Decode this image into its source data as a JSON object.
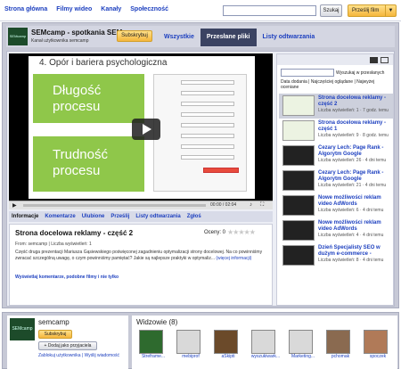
{
  "topbar": {
    "nav": [
      "Strona główna",
      "Filmy wideo",
      "Kanały",
      "Społeczność"
    ],
    "search_button": "Szukaj",
    "upload_button": "Prześlij film"
  },
  "channel": {
    "logo_text": "SEMcamp",
    "title": "SEMcamp - spotkania SEM",
    "subtitle": "Kanał użytkownika semcamp",
    "subscribe": "Subskrybuj",
    "tabs": [
      "Wszystkie",
      "Przesłane pliki",
      "Listy odtwarzania"
    ]
  },
  "player": {
    "slide_title": "4. Opór i bariera psychologiczna",
    "slide_text1": "Długość procesu",
    "slide_text2": "Trudność procesu",
    "time": "00:00 / 02:04"
  },
  "actions": [
    "Informacje",
    "Komentarze",
    "Ulubione",
    "Prześlij",
    "Listy odtwarzania",
    "Zgłoś"
  ],
  "video": {
    "title": "Strona docelowa reklamy - część 2",
    "rating_label": "Oceny: 0",
    "from": "From: semcamp | Liczba wyświetleń: 1",
    "description": "Część druga prezentacji Mariusza Gąsiewskiego poświęconej zagadnieniu optymalizacji strony docelowej. Na co powinniśmy zwracać szczególną uwagę, o czym powinniśmy pamiętać? Jakie są najlepsze praktyki w optymaliz...",
    "more_info": "(więcej informacji)",
    "comments_link": "Wyświetlaj komentarze, podobne filmy i nie tylko"
  },
  "sidebar": {
    "search_label": "Wyszukaj w przesłanych",
    "sort": "Data dodania | Najczęściej oglądane | Najwyżej oceniane",
    "items": [
      {
        "title": "Strona docelowa reklamy - część 2",
        "meta": "Liczba wyświetleń: 1 · 7 godz. temu"
      },
      {
        "title": "Strona docelowa reklamy - część 1",
        "meta": "Liczba wyświetleń: 9 · 8 godz. temu"
      },
      {
        "title": "Cezary Lech: Page Rank - Algorytm Google",
        "meta": "Liczba wyświetleń: 26 · 4 dni temu"
      },
      {
        "title": "Cezary Lech: Page Rank - Algorytm Google",
        "meta": "Liczba wyświetleń: 21 · 4 dni temu"
      },
      {
        "title": "Nowe możliwości reklam video AdWords",
        "meta": "Liczba wyświetleń: 6 · 4 dni temu"
      },
      {
        "title": "Nowe możliwości reklam video AdWords",
        "meta": "Liczba wyświetleń: 4 · 4 dni temu"
      },
      {
        "title": "Dzień Specjalisty SEO w dużym e-commerce -",
        "meta": "Liczba wyświetleń: 8 · 4 dni temu"
      }
    ]
  },
  "user": {
    "avatar_text": "SEMcamp",
    "name": "semcamp",
    "subscribe": "Subskrybuj",
    "add_friend": "+ Dodaj jako przyjaciela",
    "links": "Zablokuj użytkownika | Wyślij wiadomość"
  },
  "viewers": {
    "title": "Widzowie (8)",
    "names": [
      "Streframe...",
      "mebiprof",
      "aSkipti",
      "wyszukiwark...",
      "Marketing...",
      "pchomak",
      "spoczek"
    ]
  }
}
